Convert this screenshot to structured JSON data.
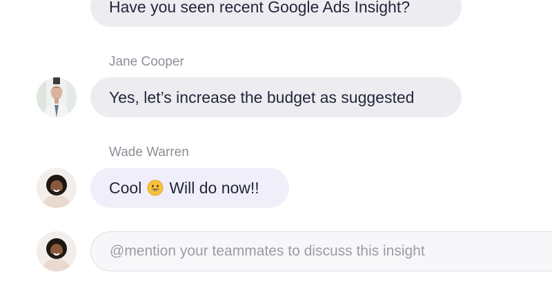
{
  "messages": [
    {
      "author": "",
      "text": "Have you seen recent Google Ads Insight?"
    },
    {
      "author": "Jane Cooper",
      "text": "Yes, let’s increase the budget as suggested",
      "avatar": "jane-cooper-avatar"
    },
    {
      "author": "Wade Warren",
      "text_before": "Cool",
      "emoji": "grinning-face-emoji",
      "text_after": "Will do now!!",
      "avatar": "wade-warren-avatar"
    }
  ],
  "composer": {
    "placeholder": "@mention your teammates to discuss this insight"
  },
  "colors": {
    "bubble_gray": "#ededf1",
    "bubble_lavender": "#f0eff9",
    "author_text": "#8c8e98",
    "message_text": "#23263a"
  }
}
